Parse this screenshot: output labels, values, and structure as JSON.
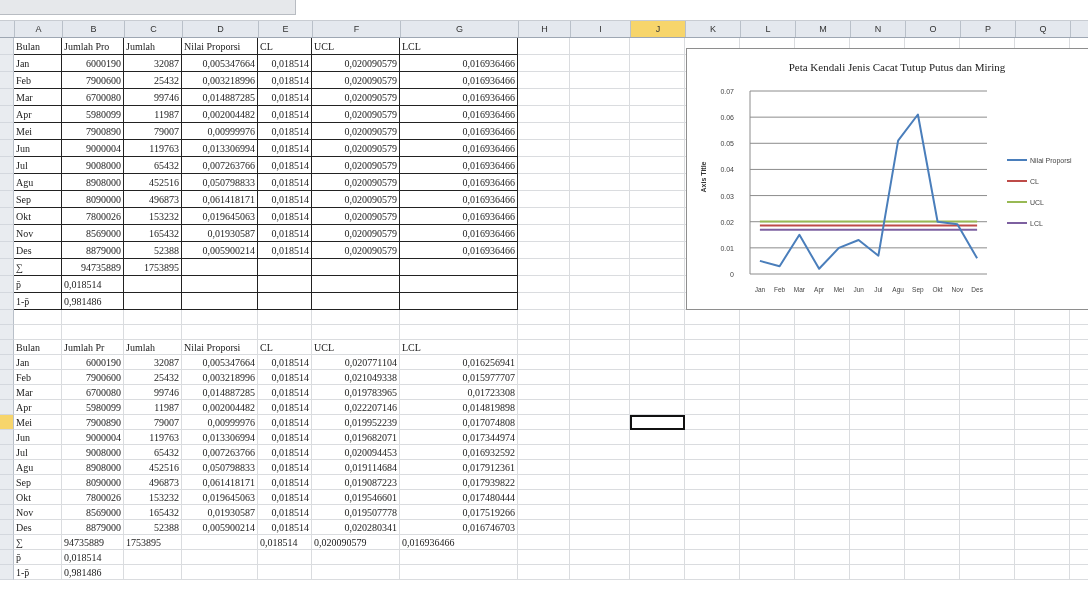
{
  "sheet": {
    "column_headers": [
      {
        "label": "A",
        "selected": false
      },
      {
        "label": "B",
        "selected": false
      },
      {
        "label": "C",
        "selected": false
      },
      {
        "label": "D",
        "selected": false
      },
      {
        "label": "E",
        "selected": false
      },
      {
        "label": "F",
        "selected": false
      },
      {
        "label": "G",
        "selected": false
      },
      {
        "label": "H",
        "selected": false
      },
      {
        "label": "I",
        "selected": false
      },
      {
        "label": "J",
        "selected": true
      },
      {
        "label": "K",
        "selected": false
      },
      {
        "label": "L",
        "selected": false
      },
      {
        "label": "M",
        "selected": false
      },
      {
        "label": "N",
        "selected": false
      },
      {
        "label": "O",
        "selected": false
      },
      {
        "label": "P",
        "selected": false
      },
      {
        "label": "Q",
        "selected": false
      }
    ],
    "tables": [
      {
        "header": [
          "Bulan",
          "Jumlah Pro",
          "Jumlah",
          "Nilai Proporsi",
          "CL",
          "UCL",
          "LCL"
        ],
        "rows": [
          {
            "kind": "data",
            "selected": false,
            "cells": [
              "Jan",
              "6000190",
              "32087",
              "0,005347664",
              "0,018514",
              "0,020090579",
              "0,016936466"
            ]
          },
          {
            "kind": "data",
            "selected": false,
            "cells": [
              "Feb",
              "7900600",
              "25432",
              "0,003218996",
              "0,018514",
              "0,020090579",
              "0,016936466"
            ]
          },
          {
            "kind": "data",
            "selected": false,
            "cells": [
              "Mar",
              "6700080",
              "99746",
              "0,014887285",
              "0,018514",
              "0,020090579",
              "0,016936466"
            ]
          },
          {
            "kind": "data",
            "selected": false,
            "cells": [
              "Apr",
              "5980099",
              "11987",
              "0,002004482",
              "0,018514",
              "0,020090579",
              "0,016936466"
            ]
          },
          {
            "kind": "data",
            "selected": false,
            "cells": [
              "Mei",
              "7900890",
              "79007",
              "0,00999976",
              "0,018514",
              "0,020090579",
              "0,016936466"
            ]
          },
          {
            "kind": "data",
            "selected": false,
            "cells": [
              "Jun",
              "9000004",
              "119763",
              "0,013306994",
              "0,018514",
              "0,020090579",
              "0,016936466"
            ]
          },
          {
            "kind": "data",
            "selected": false,
            "cells": [
              "Jul",
              "9008000",
              "65432",
              "0,007263766",
              "0,018514",
              "0,020090579",
              "0,016936466"
            ]
          },
          {
            "kind": "data",
            "selected": false,
            "cells": [
              "Agu",
              "8908000",
              "452516",
              "0,050798833",
              "0,018514",
              "0,020090579",
              "0,016936466"
            ]
          },
          {
            "kind": "data",
            "selected": false,
            "cells": [
              "Sep",
              "8090000",
              "496873",
              "0,061418171",
              "0,018514",
              "0,020090579",
              "0,016936466"
            ]
          },
          {
            "kind": "data",
            "selected": false,
            "cells": [
              "Okt",
              "7800026",
              "153232",
              "0,019645063",
              "0,018514",
              "0,020090579",
              "0,016936466"
            ]
          },
          {
            "kind": "data",
            "selected": false,
            "cells": [
              "Nov",
              "8569000",
              "165432",
              "0,01930587",
              "0,018514",
              "0,020090579",
              "0,016936466"
            ]
          },
          {
            "kind": "data",
            "selected": false,
            "cells": [
              "Des",
              "8879000",
              "52388",
              "0,005900214",
              "0,018514",
              "0,020090579",
              "0,016936466"
            ]
          },
          {
            "kind": "data",
            "selected": false,
            "cells": [
              "∑",
              "94735889",
              "1753895",
              null,
              null,
              null,
              null
            ]
          },
          {
            "kind": "text",
            "selected": false,
            "cells": [
              "p̄",
              "0,018514",
              null,
              null,
              null,
              null,
              null
            ]
          },
          {
            "kind": "text",
            "selected": false,
            "cells": [
              "1-p̄",
              "0,981486",
              null,
              null,
              null,
              null,
              null
            ]
          }
        ]
      },
      {
        "header": [
          "Bulan",
          "Jumlah Pr",
          "Jumlah",
          "Nilai Proporsi",
          "CL",
          "UCL",
          "LCL"
        ],
        "rows": [
          {
            "kind": "data",
            "selected": false,
            "cells": [
              "Jan",
              "6000190",
              "32087",
              "0,005347664",
              "0,018514",
              "0,020771104",
              "0,016256941"
            ]
          },
          {
            "kind": "data",
            "selected": false,
            "cells": [
              "Feb",
              "7900600",
              "25432",
              "0,003218996",
              "0,018514",
              "0,021049338",
              "0,015977707"
            ]
          },
          {
            "kind": "data",
            "selected": false,
            "cells": [
              "Mar",
              "6700080",
              "99746",
              "0,014887285",
              "0,018514",
              "0,019783965",
              "0,01723308"
            ]
          },
          {
            "kind": "data",
            "selected": false,
            "cells": [
              "Apr",
              "5980099",
              "11987",
              "0,002004482",
              "0,018514",
              "0,022207146",
              "0,014819898"
            ]
          },
          {
            "kind": "data",
            "selected": true,
            "cells": [
              "Mei",
              "7900890",
              "79007",
              "0,00999976",
              "0,018514",
              "0,019952239",
              "0,017074808"
            ]
          },
          {
            "kind": "data",
            "selected": false,
            "cells": [
              "Jun",
              "9000004",
              "119763",
              "0,013306994",
              "0,018514",
              "0,019682071",
              "0,017344974"
            ]
          },
          {
            "kind": "data",
            "selected": false,
            "cells": [
              "Jul",
              "9008000",
              "65432",
              "0,007263766",
              "0,018514",
              "0,020094453",
              "0,016932592"
            ]
          },
          {
            "kind": "data",
            "selected": false,
            "cells": [
              "Agu",
              "8908000",
              "452516",
              "0,050798833",
              "0,018514",
              "0,019114684",
              "0,017912361"
            ]
          },
          {
            "kind": "data",
            "selected": false,
            "cells": [
              "Sep",
              "8090000",
              "496873",
              "0,061418171",
              "0,018514",
              "0,019087223",
              "0,017939822"
            ]
          },
          {
            "kind": "data",
            "selected": false,
            "cells": [
              "Okt",
              "7800026",
              "153232",
              "0,019645063",
              "0,018514",
              "0,019546601",
              "0,017480444"
            ]
          },
          {
            "kind": "data",
            "selected": false,
            "cells": [
              "Nov",
              "8569000",
              "165432",
              "0,01930587",
              "0,018514",
              "0,019507778",
              "0,017519266"
            ]
          },
          {
            "kind": "data",
            "selected": false,
            "cells": [
              "Des",
              "8879000",
              "52388",
              "0,005900214",
              "0,018514",
              "0,020280341",
              "0,016746703"
            ]
          },
          {
            "kind": "text",
            "selected": false,
            "cells": [
              "∑",
              "94735889",
              "1753895",
              null,
              "0,018514",
              "0,020090579",
              "0,016936466"
            ]
          },
          {
            "kind": "text",
            "selected": false,
            "cells": [
              "p̄",
              "0,018514",
              null,
              null,
              null,
              null,
              null
            ]
          },
          {
            "kind": "text",
            "selected": false,
            "cells": [
              "1-p̄",
              "0,981486",
              null,
              null,
              null,
              null,
              null
            ]
          }
        ]
      }
    ],
    "chart": {
      "chart_data": {
        "type": "line",
        "title": "Peta Kendali  Jenis Cacat Tutup Putus dan Miring",
        "ylabel": "Axis Title",
        "categories": [
          "Jan",
          "Feb",
          "Mar",
          "Apr",
          "Mei",
          "Jun",
          "Jul",
          "Agu",
          "Sep",
          "Okt",
          "Nov",
          "Des"
        ],
        "series": [
          {
            "name": "Nilai Proporsi",
            "color": "#4a7ebb",
            "values": [
              0.005,
              0.003,
              0.015,
              0.002,
              0.01,
              0.013,
              0.007,
              0.051,
              0.061,
              0.02,
              0.019,
              0.006
            ]
          },
          {
            "name": "CL",
            "color": "#be4b48",
            "values": [
              0.0185,
              0.0185,
              0.0185,
              0.0185,
              0.0185,
              0.0185,
              0.0185,
              0.0185,
              0.0185,
              0.0185,
              0.0185,
              0.0185
            ]
          },
          {
            "name": "UCL",
            "color": "#98b954",
            "values": [
              0.0201,
              0.0201,
              0.0201,
              0.0201,
              0.0201,
              0.0201,
              0.0201,
              0.0201,
              0.0201,
              0.0201,
              0.0201,
              0.0201
            ]
          },
          {
            "name": "LCL",
            "color": "#7d60a0",
            "values": [
              0.0169,
              0.0169,
              0.0169,
              0.0169,
              0.0169,
              0.0169,
              0.0169,
              0.0169,
              0.0169,
              0.0169,
              0.0169,
              0.0169
            ]
          }
        ],
        "grid": true,
        "legend": true,
        "ylim": [
          0,
          0.07
        ],
        "yticks": [
          {
            "value": 0,
            "label": "0"
          },
          {
            "value": 0.01,
            "label": "0.01"
          },
          {
            "value": 0.02,
            "label": "0.02"
          },
          {
            "value": 0.03,
            "label": "0.03"
          },
          {
            "value": 0.04,
            "label": "0.04"
          },
          {
            "value": 0.05,
            "label": "0.05"
          },
          {
            "value": 0.06,
            "label": "0.06"
          },
          {
            "value": 0.07,
            "label": "0.07"
          }
        ]
      }
    }
  }
}
